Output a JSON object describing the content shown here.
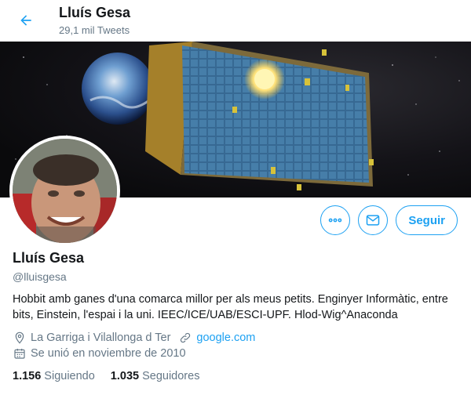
{
  "header": {
    "name": "Lluís Gesa",
    "tweet_count": "29,1 mil Tweets"
  },
  "profile": {
    "name": "Lluís Gesa",
    "handle": "@lluisgesa",
    "bio": "Hobbit amb ganes d'una comarca millor per als meus petits. Enginyer Informàtic, entre bits, Einstein, l'espai i la uni. IEEC/ICE/UAB/ESCI-UPF. Hlod-Wig^Anaconda",
    "location": "La Garriga i Vilallonga d Ter",
    "website": "google.com",
    "joined": "Se unió en noviembre de 2010"
  },
  "actions": {
    "more_icon": "more-icon",
    "message_icon": "envelope-icon",
    "follow_label": "Seguir"
  },
  "stats": {
    "following_count": "1.156",
    "following_label": "Siguiendo",
    "followers_count": "1.035",
    "followers_label": "Seguidores"
  },
  "colors": {
    "accent": "#1da1f2",
    "secondary_text": "#657786",
    "primary_text": "#14171a"
  }
}
